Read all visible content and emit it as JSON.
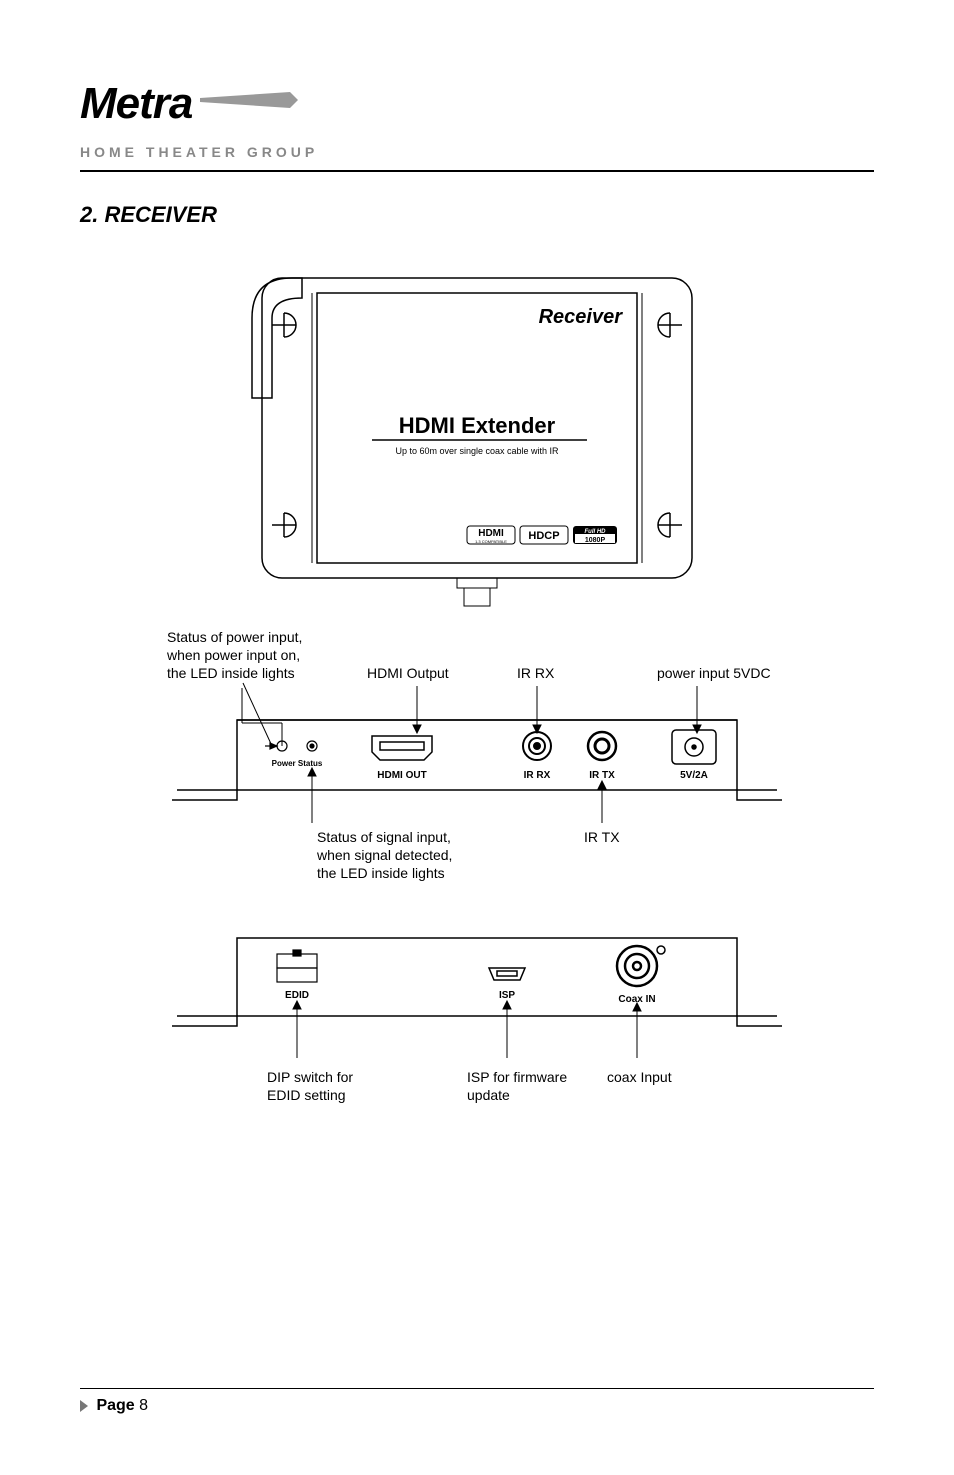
{
  "brand": {
    "name": "Metra",
    "subtitle": "HOME THEATER GROUP"
  },
  "section": {
    "number": "2.",
    "title": "RECEIVER"
  },
  "device_top": {
    "label": "Receiver",
    "product": "HDMI Extender",
    "tagline": "Up to 60m over single coax cable with IR",
    "badges": {
      "hdmi": "HDMI",
      "hdmi_sub": "1.3 COMPATIBLE",
      "hdcp": "HDCP",
      "fullhd_top": "Full HD",
      "fullhd_bottom": "1080P"
    }
  },
  "port_panel_front": {
    "callout_power": "Status of power input,\nwhen power input on,\nthe LED inside lights",
    "callout_hdmi": "HDMI Output",
    "callout_irrx": "IR RX",
    "callout_power_in": "power input 5VDC",
    "callout_status": "Status of signal input,\nwhen signal detected,\nthe LED inside lights",
    "callout_irtx": "IR TX",
    "labels": {
      "power_status": "Power Status",
      "hdmi_out": "HDMI OUT",
      "ir_rx": "IR RX",
      "ir_tx": "IR TX",
      "dc": "5V/2A"
    }
  },
  "port_panel_back": {
    "callout_dip": "DIP switch for\nEDID setting",
    "callout_isp": "ISP for firmware\nupdate",
    "callout_coax": "coax Input",
    "labels": {
      "edid": "EDID",
      "isp": "ISP",
      "coax": "Coax IN"
    }
  },
  "footer": {
    "page_label": "Page",
    "page_number": "8"
  }
}
